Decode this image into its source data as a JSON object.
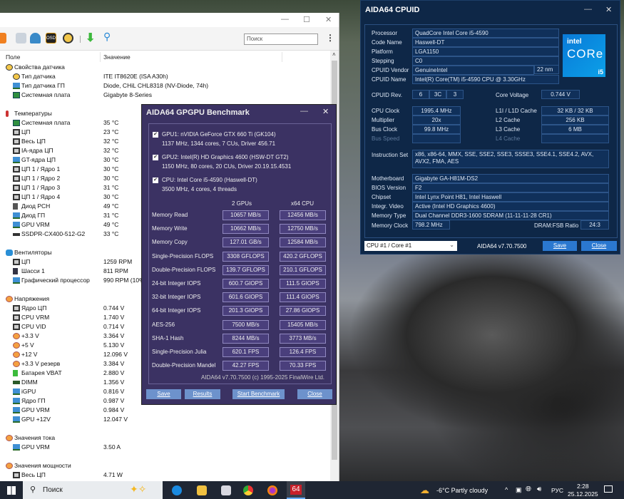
{
  "main": {
    "search_placeholder": "Поиск",
    "col_field": "Поле",
    "col_value": "Значение",
    "rows": [
      {
        "kind": "group",
        "icon": "sensor",
        "label": "Свойства датчика",
        "value": ""
      },
      {
        "kind": "item",
        "icon": "sensor",
        "label": "Тип датчика",
        "value": "ITE IT8620E  (ISA A30h)"
      },
      {
        "kind": "item",
        "icon": "gpu",
        "label": "Тип датчика ГП",
        "value": "Diode, CHiL CHL8318  (NV-Diode, 74h)"
      },
      {
        "kind": "item",
        "icon": "board",
        "label": "Системная плата",
        "value": "Gigabyte 8-Series"
      },
      {
        "kind": "gap"
      },
      {
        "kind": "group",
        "icon": "temp",
        "label": "Температуры",
        "value": ""
      },
      {
        "kind": "item",
        "icon": "board",
        "label": "Системная плата",
        "value": "35 °C"
      },
      {
        "kind": "item",
        "icon": "cpu",
        "label": "ЦП",
        "value": "23 °C"
      },
      {
        "kind": "item",
        "icon": "cpu",
        "label": "Весь ЦП",
        "value": "32 °C"
      },
      {
        "kind": "item",
        "icon": "cpu",
        "label": "IA-ядра ЦП",
        "value": "32 °C"
      },
      {
        "kind": "item",
        "icon": "gpu",
        "label": "GT-ядра ЦП",
        "value": "30 °C"
      },
      {
        "kind": "item",
        "icon": "cpu",
        "label": "ЦП 1 / Ядро 1",
        "value": "30 °C"
      },
      {
        "kind": "item",
        "icon": "cpu",
        "label": "ЦП 1 / Ядро 2",
        "value": "30 °C"
      },
      {
        "kind": "item",
        "icon": "cpu",
        "label": "ЦП 1 / Ядро 3",
        "value": "31 °C"
      },
      {
        "kind": "item",
        "icon": "cpu",
        "label": "ЦП 1 / Ядро 4",
        "value": "30 °C"
      },
      {
        "kind": "item",
        "icon": "pch",
        "label": "Диод PCH",
        "value": "49 °C"
      },
      {
        "kind": "item",
        "icon": "gpu",
        "label": "Диод ГП",
        "value": "31 °C"
      },
      {
        "kind": "item",
        "icon": "gpu",
        "label": "GPU VRM",
        "value": "49 °C"
      },
      {
        "kind": "item",
        "icon": "ssd",
        "label": "SSDPR-CX400-512-G2",
        "value": "33 °C"
      },
      {
        "kind": "gap"
      },
      {
        "kind": "group",
        "icon": "fan",
        "label": "Вентиляторы",
        "value": ""
      },
      {
        "kind": "item",
        "icon": "cpu",
        "label": "ЦП",
        "value": "1259 RPM"
      },
      {
        "kind": "item",
        "icon": "chassis",
        "label": "Шасси 1",
        "value": "811 RPM"
      },
      {
        "kind": "item",
        "icon": "gpu",
        "label": "Графический процессор",
        "value": "990 RPM  (10%)"
      },
      {
        "kind": "gap"
      },
      {
        "kind": "group",
        "icon": "volt",
        "label": "Напряжения",
        "value": ""
      },
      {
        "kind": "item",
        "icon": "cpu",
        "label": "Ядро ЦП",
        "value": "0.744 V"
      },
      {
        "kind": "item",
        "icon": "cpu",
        "label": "CPU VRM",
        "value": "1.740 V"
      },
      {
        "kind": "item",
        "icon": "cpu",
        "label": "CPU VID",
        "value": "0.714 V"
      },
      {
        "kind": "item",
        "icon": "volt",
        "label": "+3.3 V",
        "value": "3.364 V"
      },
      {
        "kind": "item",
        "icon": "volt",
        "label": "+5 V",
        "value": "5.130 V"
      },
      {
        "kind": "item",
        "icon": "volt",
        "label": "+12 V",
        "value": "12.096 V"
      },
      {
        "kind": "item",
        "icon": "volt",
        "label": "+3.3 V резерв",
        "value": "3.384 V"
      },
      {
        "kind": "item",
        "icon": "battery",
        "label": "Батарея VBAT",
        "value": "2.880 V"
      },
      {
        "kind": "item",
        "icon": "dimm",
        "label": "DIMM",
        "value": "1.356 V"
      },
      {
        "kind": "item",
        "icon": "gpu",
        "label": "iGPU",
        "value": "0.816 V"
      },
      {
        "kind": "item",
        "icon": "gpu",
        "label": "Ядро ГП",
        "value": "0.987 V"
      },
      {
        "kind": "item",
        "icon": "gpu",
        "label": "GPU VRM",
        "value": "0.984 V"
      },
      {
        "kind": "item",
        "icon": "gpu",
        "label": "GPU +12V",
        "value": "12.047 V"
      },
      {
        "kind": "gap"
      },
      {
        "kind": "group",
        "icon": "volt",
        "label": "Значения тока",
        "value": ""
      },
      {
        "kind": "item",
        "icon": "gpu",
        "label": "GPU VRM",
        "value": "3.50 A"
      },
      {
        "kind": "gap"
      },
      {
        "kind": "group",
        "icon": "volt",
        "label": "Значения мощности",
        "value": ""
      },
      {
        "kind": "item",
        "icon": "cpu",
        "label": "Весь ЦП",
        "value": "4.71 W"
      }
    ]
  },
  "gpgpu": {
    "title": "AIDA64 GPGPU Benchmark",
    "devices": [
      {
        "name": "GPU1: nVIDIA GeForce GTX 660 Ti (GK104)",
        "detail": "1137 MHz, 1344 cores, 7 CUs, Driver 456.71",
        "checked": true
      },
      {
        "name": "GPU2: Intel(R) HD Graphics 4600 (HSW-DT GT2)",
        "detail": "1150 MHz, 80 cores, 20 CUs, Driver 20.19.15.4531",
        "checked": true
      },
      {
        "name": "CPU: Intel Core i5-4590 (Haswell-DT)",
        "detail": "3500 MHz, 4 cores, 4 threads",
        "checked": true
      }
    ],
    "col1": "2 GPUs",
    "col2": "x64 CPU",
    "results": [
      {
        "label": "Memory Read",
        "gpu": "10657 MB/s",
        "cpu": "12456 MB/s"
      },
      {
        "label": "Memory Write",
        "gpu": "10662 MB/s",
        "cpu": "12750 MB/s"
      },
      {
        "label": "Memory Copy",
        "gpu": "127.01 GB/s",
        "cpu": "12584 MB/s"
      },
      {
        "label": "Single-Precision FLOPS",
        "gpu": "3308 GFLOPS",
        "cpu": "420.2 GFLOPS"
      },
      {
        "label": "Double-Precision FLOPS",
        "gpu": "139.7 GFLOPS",
        "cpu": "210.1 GFLOPS"
      },
      {
        "label": "24-bit Integer IOPS",
        "gpu": "600.7 GIOPS",
        "cpu": "111.5 GIOPS"
      },
      {
        "label": "32-bit Integer IOPS",
        "gpu": "601.6 GIOPS",
        "cpu": "111.4 GIOPS"
      },
      {
        "label": "64-bit Integer IOPS",
        "gpu": "201.3 GIOPS",
        "cpu": "27.86 GIOPS"
      },
      {
        "label": "AES-256",
        "gpu": "7500 MB/s",
        "cpu": "15405 MB/s"
      },
      {
        "label": "SHA-1 Hash",
        "gpu": "8244 MB/s",
        "cpu": "3773 MB/s"
      },
      {
        "label": "Single-Precision Julia",
        "gpu": "620.1 FPS",
        "cpu": "126.4 FPS"
      },
      {
        "label": "Double-Precision Mandel",
        "gpu": "42.27 FPS",
        "cpu": "70.33 FPS"
      }
    ],
    "footer": "AIDA64 v7.70.7500 (c) 1995-2025 FinalWire Ltd.",
    "buttons": {
      "save": "Save",
      "results": "Results",
      "start": "Start Benchmark",
      "close": "Close"
    }
  },
  "cpuid": {
    "title": "AIDA64 CPUID",
    "top": [
      {
        "label": "Processor",
        "value": "QuadCore Intel Core i5-4590"
      },
      {
        "label": "Code Name",
        "value": "Haswell-DT"
      },
      {
        "label": "Platform",
        "value": "LGA1150"
      },
      {
        "label": "Stepping",
        "value": "C0"
      },
      {
        "label": "CPUID Vendor",
        "value": "GenuineIntel"
      },
      {
        "label": "CPUID Name",
        "value": "Intel(R) Core(TM) i5-4590 CPU @ 3.30GHz"
      }
    ],
    "process": "22 nm",
    "logo": {
      "brand": "intel",
      "line": "CORe",
      "tier": "i5"
    },
    "rev_label": "CPUID Rev.",
    "rev": [
      "6",
      "3C",
      "3"
    ],
    "core_voltage_label": "Core Voltage",
    "core_voltage": "0.744 V",
    "clocks": [
      {
        "label": "CPU Clock",
        "value": "1995.4 MHz"
      },
      {
        "label": "Multiplier",
        "value": "20x"
      },
      {
        "label": "Bus Clock",
        "value": "99.8 MHz"
      },
      {
        "label": "Bus Speed",
        "value": ""
      }
    ],
    "caches": [
      {
        "label": "L1I / L1D Cache",
        "value": "32 KB / 32 KB"
      },
      {
        "label": "L2 Cache",
        "value": "256 KB"
      },
      {
        "label": "L3 Cache",
        "value": "6 MB"
      },
      {
        "label": "L4 Cache",
        "value": ""
      }
    ],
    "iset_label": "Instruction Set",
    "iset": "x86, x86-64, MMX, SSE, SSE2, SSE3, SSSE3, SSE4.1, SSE4.2, AVX, AVX2, FMA, AES",
    "board": [
      {
        "label": "Motherboard",
        "value": "Gigabyte GA-H81M-DS2"
      },
      {
        "label": "BIOS Version",
        "value": "F2"
      },
      {
        "label": "Chipset",
        "value": "Intel Lynx Point H81, Intel Haswell"
      },
      {
        "label": "Integr. Video",
        "value": "Active  (Intel HD Graphics 4600)"
      },
      {
        "label": "Memory Type",
        "value": "Dual Channel DDR3-1600 SDRAM  (11-11-11-28 CR1)"
      }
    ],
    "memclock_label": "Memory Clock",
    "memclock": "798.2 MHz",
    "ratio_label": "DRAM:FSB Ratio",
    "ratio": "24:3",
    "core_select": "CPU #1 / Core #1",
    "version": "AIDA64 v7.70.7500",
    "save": "Save",
    "close": "Close"
  },
  "taskbar": {
    "search": "Поиск",
    "weather": "-6°C  Partly cloudy",
    "lang": "РУС",
    "time": "2:28",
    "date": "25.12.2025",
    "aida_label": "64"
  }
}
